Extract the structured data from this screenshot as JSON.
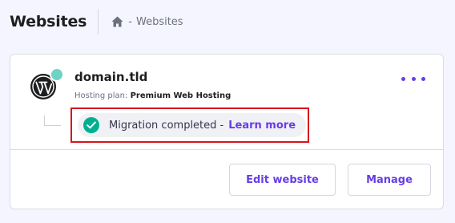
{
  "header": {
    "title": "Websites",
    "breadcrumb": {
      "separator": "-",
      "current": "Websites",
      "home_icon": "home-icon"
    }
  },
  "website": {
    "domain": "domain.tld",
    "platform_icon": "wordpress-icon",
    "status_color": "#6ed3c4",
    "plan_label": "Hosting plan:",
    "plan_value": "Premium Web Hosting",
    "more_icon": "more-dots-icon",
    "migration": {
      "status_icon": "check-circle-icon",
      "text": "Migration completed -",
      "link": "Learn more"
    }
  },
  "actions": {
    "edit_label": "Edit website",
    "manage_label": "Manage"
  },
  "colors": {
    "accent": "#673de6",
    "success": "#00b090",
    "highlight": "#d8141c",
    "background": "#f4f5ff"
  }
}
